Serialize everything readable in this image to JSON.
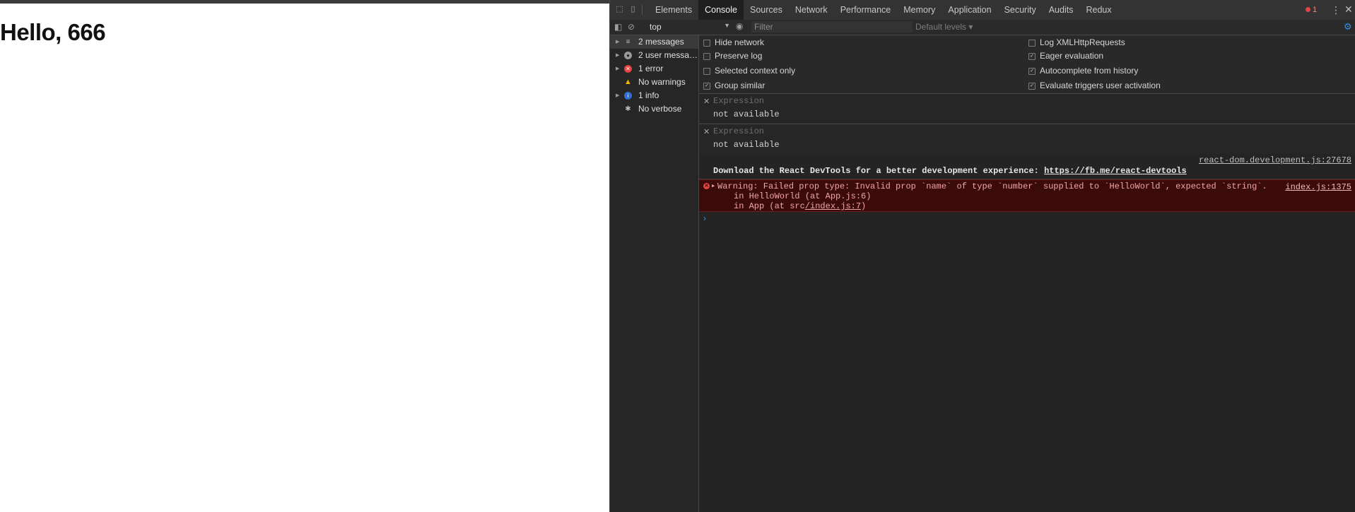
{
  "page": {
    "heading": "Hello, 666"
  },
  "devtools": {
    "tabs": [
      {
        "label": "Elements"
      },
      {
        "label": "Console",
        "active": true
      },
      {
        "label": "Sources"
      },
      {
        "label": "Network"
      },
      {
        "label": "Performance"
      },
      {
        "label": "Memory"
      },
      {
        "label": "Application"
      },
      {
        "label": "Security"
      },
      {
        "label": "Audits"
      },
      {
        "label": "Redux"
      }
    ],
    "error_count": "1",
    "toolbar": {
      "context": "top",
      "filter_placeholder": "Filter",
      "levels": "Default levels ▾"
    },
    "sidebar": [
      {
        "label": "2 messages",
        "icon": "list-icon"
      },
      {
        "label": "2 user messa…",
        "icon": "user-icon"
      },
      {
        "label": "1 error",
        "icon": "error-icon"
      },
      {
        "label": "No warnings",
        "icon": "warning-icon"
      },
      {
        "label": "1 info",
        "icon": "info-icon"
      },
      {
        "label": "No verbose",
        "icon": "bug-icon"
      }
    ],
    "settings": {
      "left": [
        {
          "label": "Hide network",
          "checked": false
        },
        {
          "label": "Preserve log",
          "checked": false
        },
        {
          "label": "Selected context only",
          "checked": false
        },
        {
          "label": "Group similar",
          "checked": true
        }
      ],
      "right": [
        {
          "label": "Log XMLHttpRequests",
          "checked": false
        },
        {
          "label": "Eager evaluation",
          "checked": true
        },
        {
          "label": "Autocomplete from history",
          "checked": true
        },
        {
          "label": "Evaluate triggers user activation",
          "checked": true
        }
      ]
    },
    "expressions": [
      {
        "placeholder": "Expression",
        "value": "not available"
      },
      {
        "placeholder": "Expression",
        "value": "not available"
      }
    ],
    "messages": {
      "log_source": "react-dom.development.js:27678",
      "log_text": "Download the React DevTools for a better development experience: ",
      "log_link": "https://fb.me/react-devtools",
      "error_source": "index.js:1375",
      "error_line1": "Warning: Failed prop type: Invalid prop `name` of type `number` supplied to `HelloWorld`, expected `string`.",
      "error_line2": "in HelloWorld (at App.js:6)",
      "error_line3_prefix": "in App (at src",
      "error_line3_link": "/index.js:7",
      "error_line3_suffix": ")"
    },
    "colors": {
      "accent": "#3b8fe0",
      "error": "#e64343",
      "warning": "#f0b400"
    }
  }
}
